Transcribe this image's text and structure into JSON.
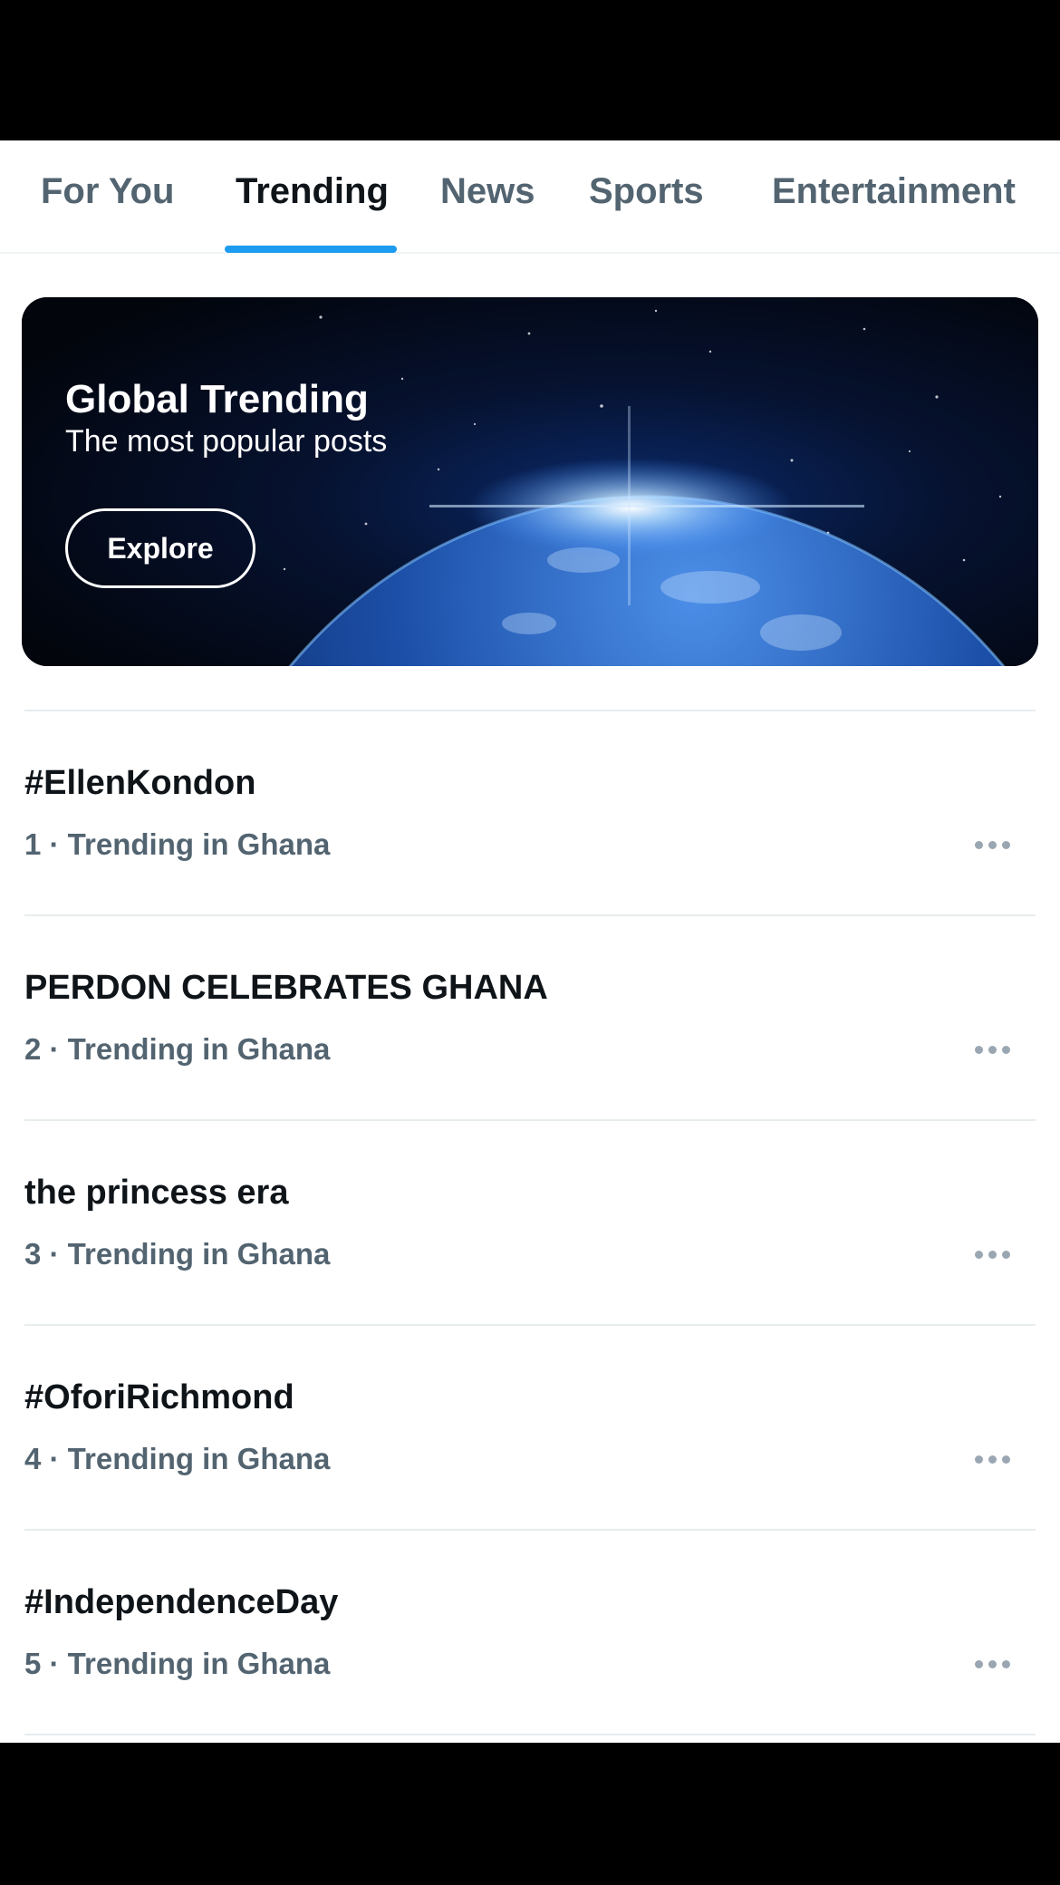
{
  "tabs": [
    {
      "label": "For You",
      "active": false
    },
    {
      "label": "Trending",
      "active": true
    },
    {
      "label": "News",
      "active": false
    },
    {
      "label": "Sports",
      "active": false
    },
    {
      "label": "Entertainment",
      "active": false
    }
  ],
  "banner": {
    "title": "Global Trending",
    "subtitle": "The most popular posts",
    "button_label": "Explore"
  },
  "trends": [
    {
      "title": "#EllenKondon",
      "meta": "1 · Trending in Ghana"
    },
    {
      "title": "PERDON CELEBRATES GHANA",
      "meta": "2 · Trending in Ghana"
    },
    {
      "title": "the princess era",
      "meta": "3 · Trending in Ghana"
    },
    {
      "title": "#OforiRichmond",
      "meta": "4 · Trending in Ghana"
    },
    {
      "title": "#IndependenceDay",
      "meta": "5 · Trending in Ghana"
    }
  ],
  "icons": {
    "more": "more-horizontal-icon"
  },
  "colors": {
    "accent": "#1d9bf0",
    "text_primary": "#0f1419",
    "text_secondary": "#536471"
  }
}
